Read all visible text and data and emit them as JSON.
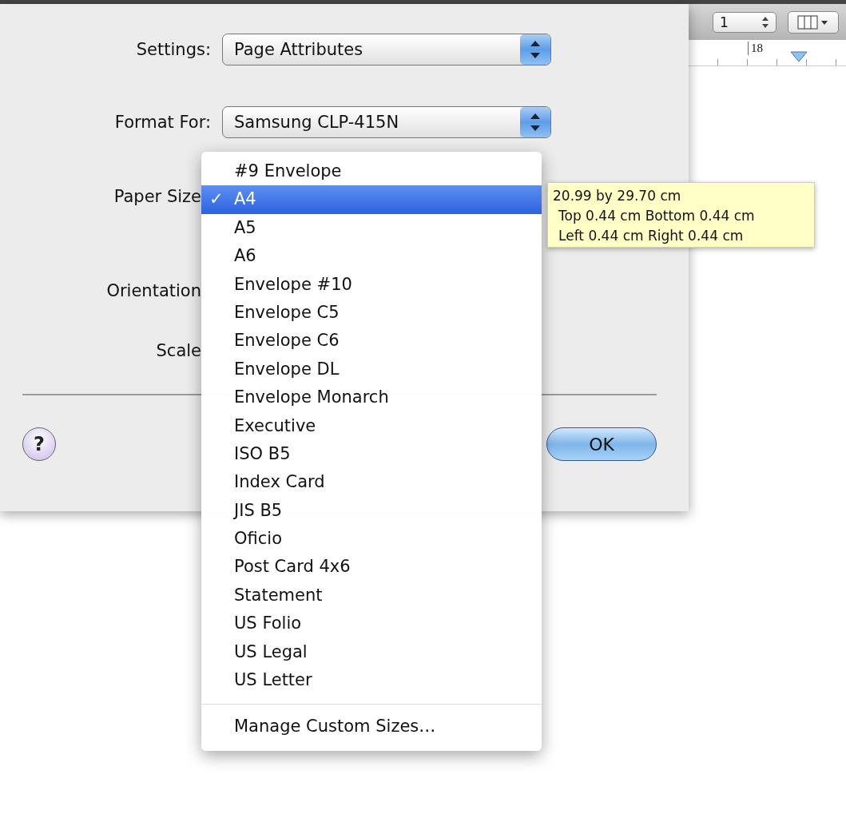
{
  "toolbar": {
    "page_stepper": "1",
    "ruler_mark": "18"
  },
  "dialog": {
    "fields": [
      {
        "label": "Settings:",
        "value": "Page Attributes"
      },
      {
        "label": "Format For:",
        "value": "Samsung CLP-415N"
      }
    ],
    "covered_labels": [
      "Paper Size",
      "Orientation",
      "Scale"
    ],
    "help_button": "?",
    "ok_button": "OK"
  },
  "paper_menu": {
    "items": [
      {
        "label": "#9 Envelope",
        "selected": false
      },
      {
        "label": "A4",
        "selected": true
      },
      {
        "label": "A5",
        "selected": false
      },
      {
        "label": "A6",
        "selected": false
      },
      {
        "label": "Envelope #10",
        "selected": false
      },
      {
        "label": "Envelope C5",
        "selected": false
      },
      {
        "label": "Envelope C6",
        "selected": false
      },
      {
        "label": "Envelope DL",
        "selected": false
      },
      {
        "label": "Envelope Monarch",
        "selected": false
      },
      {
        "label": "Executive",
        "selected": false
      },
      {
        "label": "ISO B5",
        "selected": false
      },
      {
        "label": "Index Card",
        "selected": false
      },
      {
        "label": "JIS B5",
        "selected": false
      },
      {
        "label": "Oficio",
        "selected": false
      },
      {
        "label": "Post Card 4x6",
        "selected": false
      },
      {
        "label": "Statement",
        "selected": false
      },
      {
        "label": "US Folio",
        "selected": false
      },
      {
        "label": "US Legal",
        "selected": false
      },
      {
        "label": "US Letter",
        "selected": false
      }
    ],
    "check_mark": "✓",
    "footer": "Manage Custom Sizes…"
  },
  "tooltip": {
    "lines": [
      "20.99 by 29.70 cm",
      "Top 0.44 cm Bottom 0.44 cm",
      "Left 0.44 cm Right 0.44 cm"
    ]
  }
}
